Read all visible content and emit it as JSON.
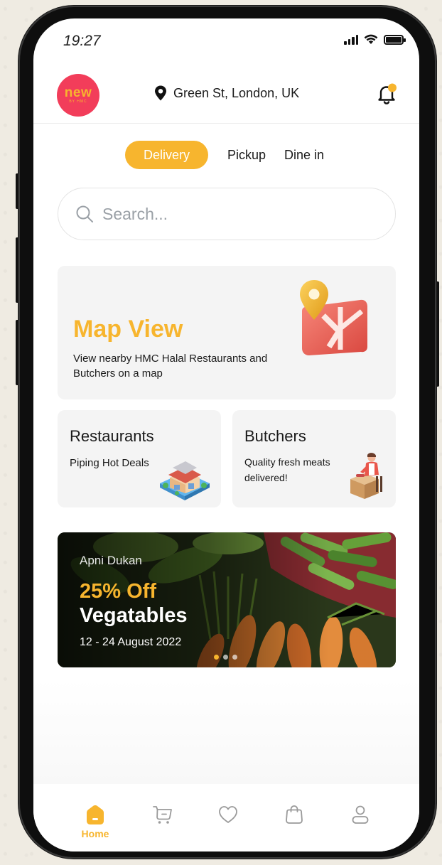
{
  "status_bar": {
    "time": "19:27"
  },
  "header": {
    "logo_main": "new",
    "logo_sub": "BY HMC",
    "location": "Green St, London, UK"
  },
  "tabs": [
    {
      "label": "Delivery",
      "active": true
    },
    {
      "label": "Pickup",
      "active": false
    },
    {
      "label": "Dine in",
      "active": false
    }
  ],
  "search": {
    "placeholder": "Search..."
  },
  "map_card": {
    "title": "Map View",
    "description": "View nearby HMC Halal Restaurants and Butchers on a map"
  },
  "categories": [
    {
      "title": "Restaurants",
      "description": "Piping Hot Deals",
      "icon": "restaurant-building-icon"
    },
    {
      "title": "Butchers",
      "description": "Quality fresh meats delivered!",
      "icon": "butcher-icon"
    }
  ],
  "banner": {
    "store": "Apni Dukan",
    "discount": "25% Off",
    "product": "Vegatables",
    "dates": "12 - 24 August 2022",
    "page_count": 3,
    "active_page": 1
  },
  "bottom_nav": [
    {
      "label": "Home",
      "icon": "home-icon",
      "active": true
    },
    {
      "label": "",
      "icon": "cart-icon",
      "active": false
    },
    {
      "label": "",
      "icon": "heart-icon",
      "active": false
    },
    {
      "label": "",
      "icon": "bag-icon",
      "active": false
    },
    {
      "label": "",
      "icon": "profile-icon",
      "active": false
    }
  ],
  "colors": {
    "accent": "#f7b52e",
    "logo_bg": "#f23d5a",
    "card_bg": "#f4f4f4",
    "notification_dot": "#f7b52e"
  }
}
